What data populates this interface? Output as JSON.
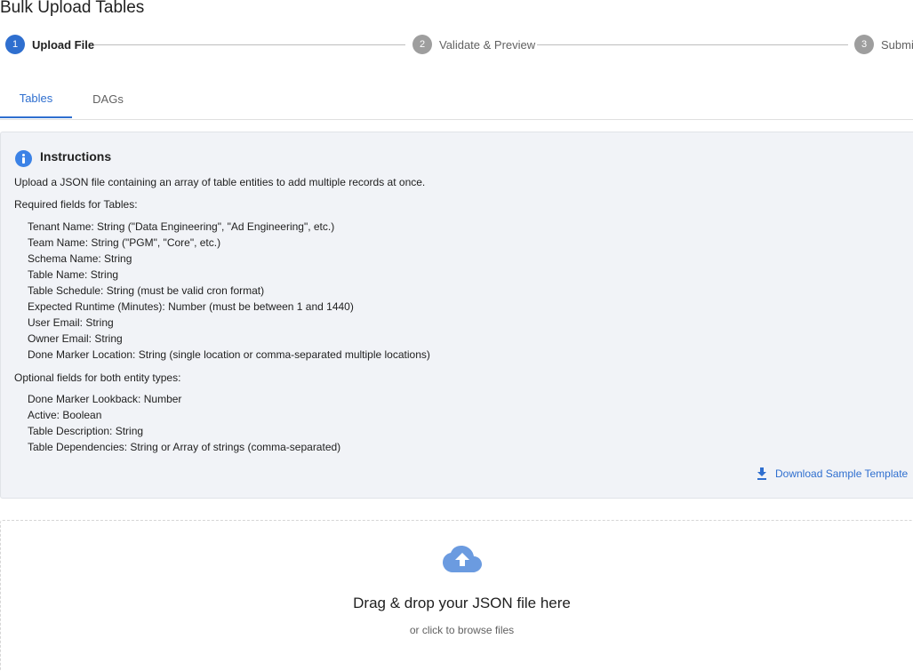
{
  "page": {
    "title": "Bulk Upload Tables"
  },
  "stepper": {
    "steps": [
      {
        "number": "1",
        "label": "Upload File",
        "active": true
      },
      {
        "number": "2",
        "label": "Validate & Preview",
        "active": false
      },
      {
        "number": "3",
        "label": "Submit",
        "active": false
      }
    ]
  },
  "tabs": [
    {
      "label": "Tables",
      "active": true
    },
    {
      "label": "DAGs",
      "active": false
    }
  ],
  "instructions": {
    "heading": "Instructions",
    "intro": "Upload a JSON file containing an array of table entities to add multiple records at once.",
    "required_heading": "Required fields for Tables:",
    "required_fields": [
      "Tenant Name: String (\"Data Engineering\", \"Ad Engineering\", etc.)",
      "Team Name: String (\"PGM\", \"Core\", etc.)",
      "Schema Name: String",
      "Table Name: String",
      "Table Schedule: String (must be valid cron format)",
      "Expected Runtime (Minutes): Number (must be between 1 and 1440)",
      "User Email: String",
      "Owner Email: String",
      "Done Marker Location: String (single location or comma-separated multiple locations)"
    ],
    "optional_heading": "Optional fields for both entity types:",
    "optional_fields": [
      "Done Marker Lookback: Number",
      "Active: Boolean",
      "Table Description: String",
      "Table Dependencies: String or Array of strings (comma-separated)"
    ],
    "download_label": "Download Sample Template"
  },
  "dropzone": {
    "title": "Drag & drop your JSON file here",
    "subtitle": "or click to browse files"
  },
  "colors": {
    "accent": "#2f6fcf",
    "inactive_step": "#9e9e9e",
    "panel_bg": "#f1f3f7",
    "info_icon": "#3b82e6",
    "cloud_icon": "#6b9be0"
  },
  "icons": {
    "info": "info-icon",
    "download": "download-icon",
    "upload": "cloud-upload-icon"
  }
}
